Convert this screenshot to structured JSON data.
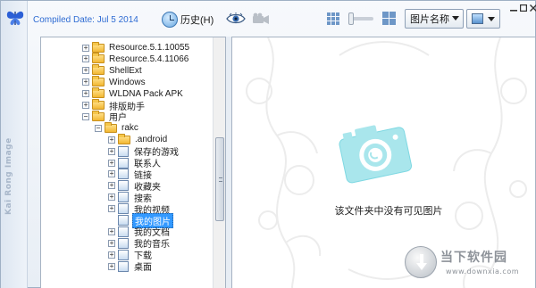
{
  "app": {
    "compiled_text": "Compiled Date: Jul  5 2014",
    "vertical_brand": "Kai Rong Image"
  },
  "toolbar": {
    "history_label": "历史(H)",
    "sort_label": "图片名称"
  },
  "tree": {
    "items": [
      {
        "label": "Resource.5.1.10055",
        "expander": "+",
        "icon": "folder-icon"
      },
      {
        "label": "Resource.5.4.11066",
        "expander": "+",
        "icon": "folder-icon"
      },
      {
        "label": "ShellExt",
        "expander": "+",
        "icon": "folder-icon"
      },
      {
        "label": "Windows",
        "expander": "+",
        "icon": "folder-icon"
      },
      {
        "label": "WLDNA Pack APK",
        "expander": "+",
        "icon": "folder-icon"
      },
      {
        "label": "排版助手",
        "expander": "+",
        "icon": "folder-icon"
      },
      {
        "label": "用户",
        "expander": "−",
        "icon": "folder-icon"
      },
      {
        "label": "rakc",
        "expander": "−",
        "icon": "user-folder-icon"
      },
      {
        "label": ".android",
        "expander": "+",
        "icon": "folder-icon"
      },
      {
        "label": "保存的游戏",
        "expander": "+",
        "icon": "saved-games-icon"
      },
      {
        "label": "联系人",
        "expander": "+",
        "icon": "contacts-icon"
      },
      {
        "label": "链接",
        "expander": "+",
        "icon": "links-icon"
      },
      {
        "label": "收藏夹",
        "expander": "+",
        "icon": "favorites-icon"
      },
      {
        "label": "搜索",
        "expander": "+",
        "icon": "search-folder-icon"
      },
      {
        "label": "我的视频",
        "expander": "+",
        "icon": "videos-icon"
      },
      {
        "label": "我的图片",
        "expander": "",
        "icon": "pictures-icon",
        "selected": true
      },
      {
        "label": "我的文档",
        "expander": "+",
        "icon": "documents-icon"
      },
      {
        "label": "我的音乐",
        "expander": "+",
        "icon": "music-icon"
      },
      {
        "label": "下载",
        "expander": "+",
        "icon": "downloads-icon"
      },
      {
        "label": "桌面",
        "expander": "+",
        "icon": "desktop-icon"
      }
    ]
  },
  "preview": {
    "empty_message": "该文件夹中没有可见图片"
  },
  "watermark": {
    "title": "当下软件园",
    "domain": "www.downxia.com"
  },
  "colors": {
    "accent_blue": "#2e6bd3",
    "selection": "#3399ff",
    "camera_teal": "#7fd8e2"
  }
}
